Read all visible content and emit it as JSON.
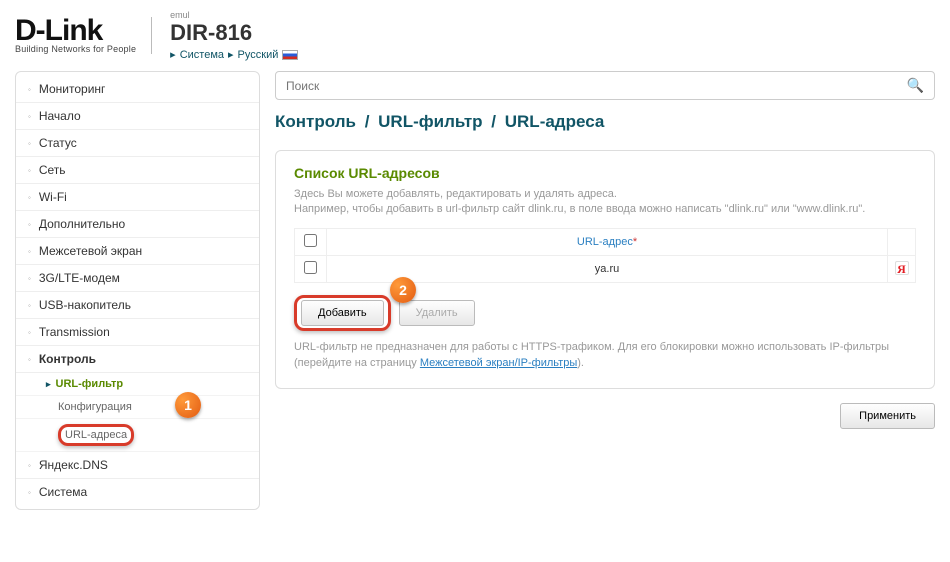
{
  "header": {
    "logo": "D-Link",
    "tagline": "Building Networks for People",
    "emul": "emul",
    "model": "DIR-816",
    "crumb1": "Система",
    "crumb2": "Русский"
  },
  "sidebar": {
    "items": [
      "Мониторинг",
      "Начало",
      "Статус",
      "Сеть",
      "Wi-Fi",
      "Дополнительно",
      "Межсетевой экран",
      "3G/LTE-модем",
      "USB-накопитель",
      "Transmission"
    ],
    "control": "Контроль",
    "url_filter": "URL-фильтр",
    "config": "Конфигурация",
    "url_addresses": "URL-адреса",
    "yandex_dns": "Яндекс.DNS",
    "system": "Система"
  },
  "content": {
    "search_placeholder": "Поиск",
    "breadcrumb": [
      "Контроль",
      "URL-фильтр",
      "URL-адреса"
    ],
    "section_title": "Список URL-адресов",
    "hint1": "Здесь Вы можете добавлять, редактировать и удалять адреса.",
    "hint2": "Например, чтобы добавить в url-фильтр сайт dlink.ru, в поле ввода можно написать \"dlink.ru\" или \"www.dlink.ru\".",
    "col_url": "URL-адрес",
    "rows": [
      {
        "url": "ya.ru"
      }
    ],
    "add_label": "Добавить",
    "delete_label": "Удалить",
    "note_prefix": "URL-фильтр не предназначен для работы с HTTPS-трафиком. Для его блокировки можно использовать IP-фильтры (перейдите на страницу ",
    "note_link": "Межсетевой экран/IP-фильтры",
    "note_suffix": ").",
    "apply_label": "Применить"
  },
  "callouts": {
    "one": "1",
    "two": "2"
  }
}
